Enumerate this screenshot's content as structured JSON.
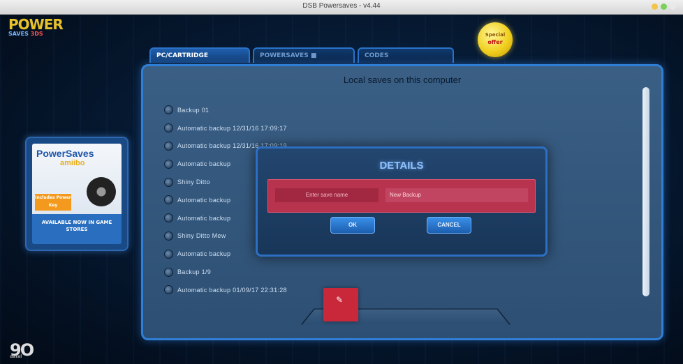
{
  "window": {
    "title": "DSB Powersaves - v4.44"
  },
  "logo": {
    "line1": "POWER",
    "line2a": "SAVES",
    "line2b": "3DS"
  },
  "badge": {
    "top": "Special",
    "bottom": "offer"
  },
  "ad": {
    "brand": "PowerSaves",
    "brand2": "amiibo",
    "tag": "Includes Power Key",
    "cta": "AVAILABLE NOW IN GAME STORES"
  },
  "footer_logo": {
    "mark": "9O",
    "small": "datel"
  },
  "tabs": [
    {
      "label": "PC/CARTRIDGE"
    },
    {
      "label": "POWERSAVES ■"
    },
    {
      "label": "CODES"
    }
  ],
  "panel": {
    "heading": "Local saves on this computer",
    "saves": [
      "Backup 01",
      "Automatic backup 12/31/16 17:09:17",
      "Automatic backup 12/31/16 17:09:19",
      "Automatic backup",
      "Shiny Ditto",
      "Automatic backup",
      "Automatic backup",
      "Shiny Ditto Mew",
      "Automatic backup",
      "Backup 1/9",
      "Automatic backup 01/09/17 22:31:28"
    ]
  },
  "dialog": {
    "title": "DETAILS",
    "field_label": "Enter save name",
    "field_value": "New Backup",
    "ok_label": "OK",
    "cancel_label": "CANCEL"
  },
  "colors": {
    "accent": "#2f7fd6",
    "dialog_row": "#b8344e",
    "cartridge_button": "#c8283a"
  }
}
